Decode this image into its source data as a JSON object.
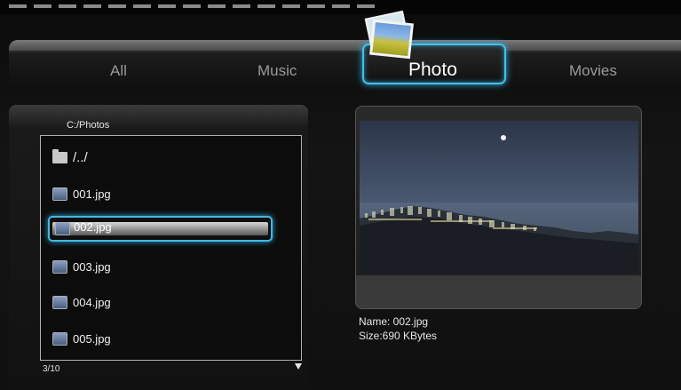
{
  "tabs": [
    {
      "label": "All"
    },
    {
      "label": "Music"
    },
    {
      "label": "Photo",
      "selected": true
    },
    {
      "label": "Movies"
    }
  ],
  "browser": {
    "path": "C:/Photos",
    "items": [
      {
        "name": "/../",
        "icon": "folder-icon"
      },
      {
        "name": "001.jpg",
        "icon": "image-file-icon"
      },
      {
        "name": "002.jpg",
        "icon": "image-file-icon",
        "selected": true
      },
      {
        "name": "003.jpg",
        "icon": "image-file-icon"
      },
      {
        "name": "004.jpg",
        "icon": "image-file-icon"
      },
      {
        "name": "005.jpg",
        "icon": "image-file-icon"
      }
    ],
    "counter": "3/10"
  },
  "preview": {
    "name": "Name: 002.jpg",
    "size": "Size:690 KBytes"
  },
  "colors": {
    "highlight": "#46bfe6",
    "background": "#111111"
  }
}
